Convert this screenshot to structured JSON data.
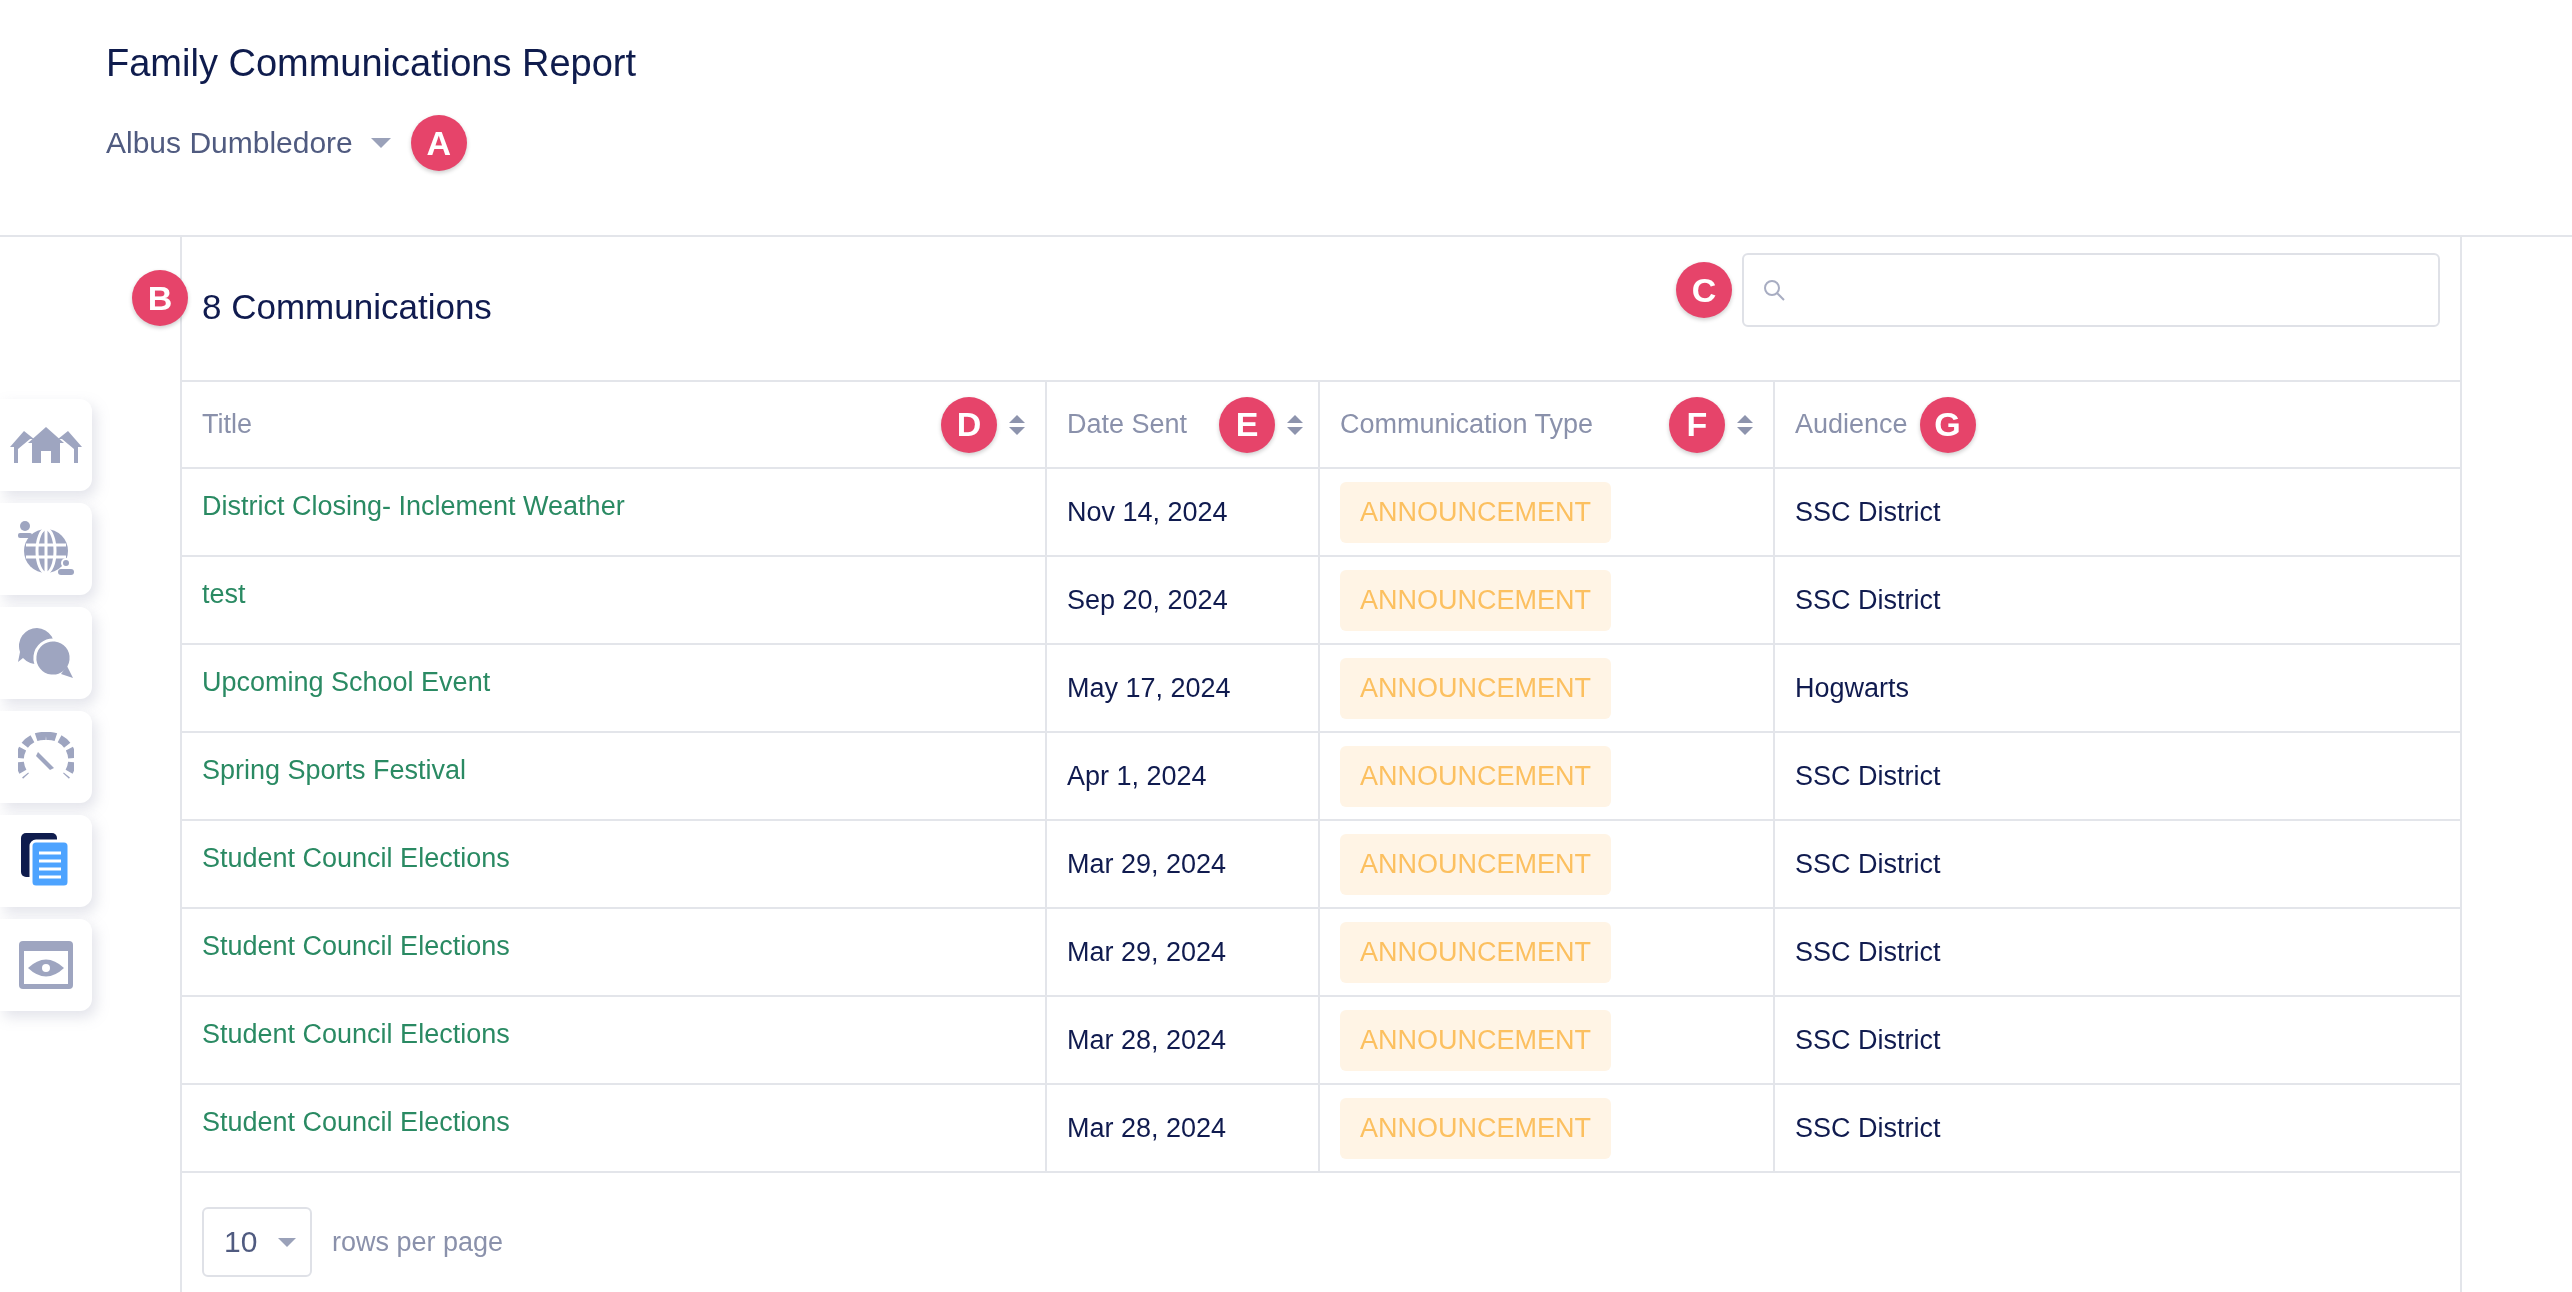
{
  "header": {
    "title": "Family Communications Report",
    "user": "Albus Dumbledore",
    "callout": "A"
  },
  "sidebar": {
    "items": [
      {
        "kind": "houses",
        "selected": false
      },
      {
        "kind": "globe",
        "selected": false
      },
      {
        "kind": "chat",
        "selected": false
      },
      {
        "kind": "gauge",
        "selected": false
      },
      {
        "kind": "documents",
        "selected": true
      },
      {
        "kind": "preview",
        "selected": false
      }
    ]
  },
  "report": {
    "count_label": "8 Communications",
    "count_callout": "B",
    "search_callout": "C"
  },
  "table": {
    "columns": [
      {
        "label": "Title",
        "sortable": true,
        "callout": "D"
      },
      {
        "label": "Date Sent",
        "sortable": true,
        "callout": "E"
      },
      {
        "label": "Communication Type",
        "sortable": true,
        "callout": "F"
      },
      {
        "label": "Audience",
        "sortable": false,
        "callout": "G"
      }
    ],
    "rows": [
      {
        "title": "District Closing- Inclement Weather",
        "date": "Nov 14, 2024",
        "type": "ANNOUNCEMENT",
        "audience": "SSC District"
      },
      {
        "title": "test",
        "date": "Sep 20, 2024",
        "type": "ANNOUNCEMENT",
        "audience": "SSC District"
      },
      {
        "title": "Upcoming School Event",
        "date": "May 17, 2024",
        "type": "ANNOUNCEMENT",
        "audience": "Hogwarts"
      },
      {
        "title": "Spring Sports Festival",
        "date": "Apr 1, 2024",
        "type": "ANNOUNCEMENT",
        "audience": "SSC District"
      },
      {
        "title": "Student Council Elections",
        "date": "Mar 29, 2024",
        "type": "ANNOUNCEMENT",
        "audience": "SSC District"
      },
      {
        "title": "Student Council Elections",
        "date": "Mar 29, 2024",
        "type": "ANNOUNCEMENT",
        "audience": "SSC District"
      },
      {
        "title": "Student Council Elections",
        "date": "Mar 28, 2024",
        "type": "ANNOUNCEMENT",
        "audience": "SSC District"
      },
      {
        "title": "Student Council Elections",
        "date": "Mar 28, 2024",
        "type": "ANNOUNCEMENT",
        "audience": "SSC District"
      }
    ]
  },
  "pagination": {
    "rows_per_page": "10",
    "label": "rows per page"
  }
}
